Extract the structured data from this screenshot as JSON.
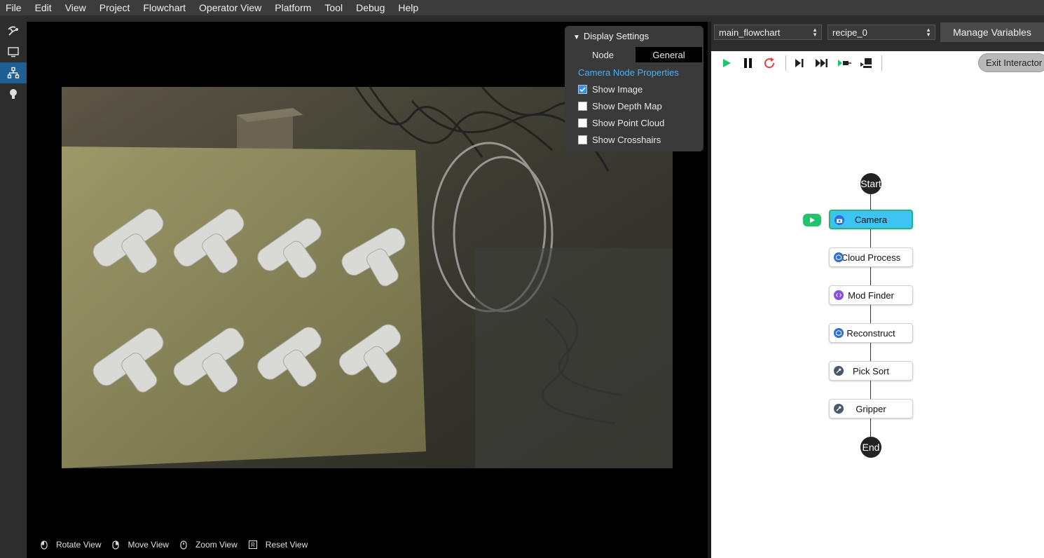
{
  "menu": [
    "File",
    "Edit",
    "View",
    "Project",
    "Flowchart",
    "Operator View",
    "Platform",
    "Tool",
    "Debug",
    "Help"
  ],
  "left_sidebar": {
    "items": [
      {
        "icon": "robot-arm-icon",
        "active": false
      },
      {
        "icon": "monitor-icon",
        "active": false
      },
      {
        "icon": "flowchart-icon",
        "active": true
      },
      {
        "icon": "lightbulb-icon",
        "active": false
      }
    ]
  },
  "display_settings": {
    "title": "Display Settings",
    "tabs": [
      "Node",
      "General"
    ],
    "active_tab": "General",
    "section": "Camera Node Properties",
    "options": [
      {
        "label": "Show Image",
        "checked": true
      },
      {
        "label": "Show Depth Map",
        "checked": false
      },
      {
        "label": "Show Point Cloud",
        "checked": false
      },
      {
        "label": "Show Crosshairs",
        "checked": false
      }
    ]
  },
  "view_hints": [
    {
      "icon": "mouse-left-icon",
      "label": "Rotate View"
    },
    {
      "icon": "mouse-right-icon",
      "label": "Move View"
    },
    {
      "icon": "mouse-wheel-icon",
      "label": "Zoom View"
    },
    {
      "icon": "key-r-icon",
      "label": "Reset View"
    }
  ],
  "flowchart_select": "main_flowchart",
  "recipe_select": "recipe_0",
  "manage_variables": "Manage Variables",
  "exit_interactor": "Exit Interactor",
  "flow": {
    "start": "Start",
    "end": "End",
    "nodes": [
      {
        "label": "Camera",
        "icon": "camera-icon",
        "icon_color": "#2d6fd6",
        "active": true
      },
      {
        "label": "Cloud Process",
        "icon": "cube-icon",
        "icon_color": "#2d6fd6",
        "active": false
      },
      {
        "label": "Mod Finder",
        "icon": "code-icon",
        "icon_color": "#8a4fe0",
        "active": false
      },
      {
        "label": "Reconstruct",
        "icon": "cube-icon",
        "icon_color": "#2d6fd6",
        "active": false
      },
      {
        "label": "Pick Sort",
        "icon": "wrench-icon",
        "icon_color": "#4a5a6a",
        "active": false
      },
      {
        "label": "Gripper",
        "icon": "wrench-icon",
        "icon_color": "#4a5a6a",
        "active": false
      }
    ]
  }
}
